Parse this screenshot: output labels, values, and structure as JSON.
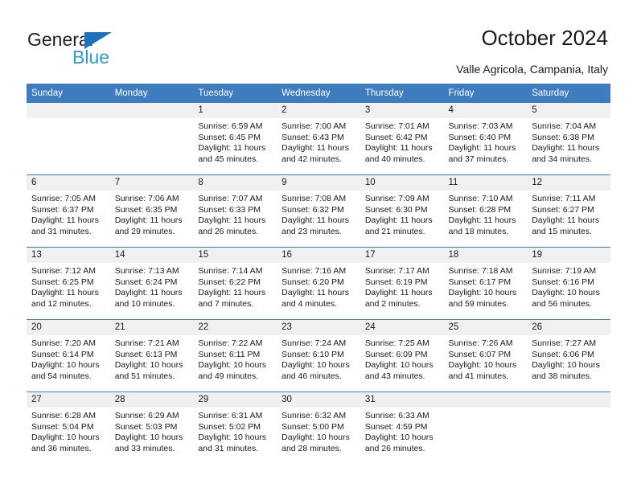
{
  "brand": {
    "name_part1": "General",
    "name_part2": "Blue",
    "logo_icon": "blue-triangle-icon"
  },
  "header": {
    "title": "October 2024",
    "subtitle": "Valle Agricola, Campania, Italy"
  },
  "colors": {
    "header_blue": "#3d7cbf",
    "brand_dark": "#231f20",
    "brand_blue": "#2e9bd6",
    "logo_triangle": "#1c72bb",
    "daynum_band": "#f0f0f0"
  },
  "calendar": {
    "weekday_headers": [
      "Sunday",
      "Monday",
      "Tuesday",
      "Wednesday",
      "Thursday",
      "Friday",
      "Saturday"
    ],
    "weeks": [
      [
        {
          "day": "",
          "lines": []
        },
        {
          "day": "",
          "lines": []
        },
        {
          "day": "1",
          "lines": [
            "Sunrise: 6:59 AM",
            "Sunset: 6:45 PM",
            "Daylight: 11 hours",
            "and 45 minutes."
          ]
        },
        {
          "day": "2",
          "lines": [
            "Sunrise: 7:00 AM",
            "Sunset: 6:43 PM",
            "Daylight: 11 hours",
            "and 42 minutes."
          ]
        },
        {
          "day": "3",
          "lines": [
            "Sunrise: 7:01 AM",
            "Sunset: 6:42 PM",
            "Daylight: 11 hours",
            "and 40 minutes."
          ]
        },
        {
          "day": "4",
          "lines": [
            "Sunrise: 7:03 AM",
            "Sunset: 6:40 PM",
            "Daylight: 11 hours",
            "and 37 minutes."
          ]
        },
        {
          "day": "5",
          "lines": [
            "Sunrise: 7:04 AM",
            "Sunset: 6:38 PM",
            "Daylight: 11 hours",
            "and 34 minutes."
          ]
        }
      ],
      [
        {
          "day": "6",
          "lines": [
            "Sunrise: 7:05 AM",
            "Sunset: 6:37 PM",
            "Daylight: 11 hours",
            "and 31 minutes."
          ]
        },
        {
          "day": "7",
          "lines": [
            "Sunrise: 7:06 AM",
            "Sunset: 6:35 PM",
            "Daylight: 11 hours",
            "and 29 minutes."
          ]
        },
        {
          "day": "8",
          "lines": [
            "Sunrise: 7:07 AM",
            "Sunset: 6:33 PM",
            "Daylight: 11 hours",
            "and 26 minutes."
          ]
        },
        {
          "day": "9",
          "lines": [
            "Sunrise: 7:08 AM",
            "Sunset: 6:32 PM",
            "Daylight: 11 hours",
            "and 23 minutes."
          ]
        },
        {
          "day": "10",
          "lines": [
            "Sunrise: 7:09 AM",
            "Sunset: 6:30 PM",
            "Daylight: 11 hours",
            "and 21 minutes."
          ]
        },
        {
          "day": "11",
          "lines": [
            "Sunrise: 7:10 AM",
            "Sunset: 6:28 PM",
            "Daylight: 11 hours",
            "and 18 minutes."
          ]
        },
        {
          "day": "12",
          "lines": [
            "Sunrise: 7:11 AM",
            "Sunset: 6:27 PM",
            "Daylight: 11 hours",
            "and 15 minutes."
          ]
        }
      ],
      [
        {
          "day": "13",
          "lines": [
            "Sunrise: 7:12 AM",
            "Sunset: 6:25 PM",
            "Daylight: 11 hours",
            "and 12 minutes."
          ]
        },
        {
          "day": "14",
          "lines": [
            "Sunrise: 7:13 AM",
            "Sunset: 6:24 PM",
            "Daylight: 11 hours",
            "and 10 minutes."
          ]
        },
        {
          "day": "15",
          "lines": [
            "Sunrise: 7:14 AM",
            "Sunset: 6:22 PM",
            "Daylight: 11 hours",
            "and 7 minutes."
          ]
        },
        {
          "day": "16",
          "lines": [
            "Sunrise: 7:16 AM",
            "Sunset: 6:20 PM",
            "Daylight: 11 hours",
            "and 4 minutes."
          ]
        },
        {
          "day": "17",
          "lines": [
            "Sunrise: 7:17 AM",
            "Sunset: 6:19 PM",
            "Daylight: 11 hours",
            "and 2 minutes."
          ]
        },
        {
          "day": "18",
          "lines": [
            "Sunrise: 7:18 AM",
            "Sunset: 6:17 PM",
            "Daylight: 10 hours",
            "and 59 minutes."
          ]
        },
        {
          "day": "19",
          "lines": [
            "Sunrise: 7:19 AM",
            "Sunset: 6:16 PM",
            "Daylight: 10 hours",
            "and 56 minutes."
          ]
        }
      ],
      [
        {
          "day": "20",
          "lines": [
            "Sunrise: 7:20 AM",
            "Sunset: 6:14 PM",
            "Daylight: 10 hours",
            "and 54 minutes."
          ]
        },
        {
          "day": "21",
          "lines": [
            "Sunrise: 7:21 AM",
            "Sunset: 6:13 PM",
            "Daylight: 10 hours",
            "and 51 minutes."
          ]
        },
        {
          "day": "22",
          "lines": [
            "Sunrise: 7:22 AM",
            "Sunset: 6:11 PM",
            "Daylight: 10 hours",
            "and 49 minutes."
          ]
        },
        {
          "day": "23",
          "lines": [
            "Sunrise: 7:24 AM",
            "Sunset: 6:10 PM",
            "Daylight: 10 hours",
            "and 46 minutes."
          ]
        },
        {
          "day": "24",
          "lines": [
            "Sunrise: 7:25 AM",
            "Sunset: 6:09 PM",
            "Daylight: 10 hours",
            "and 43 minutes."
          ]
        },
        {
          "day": "25",
          "lines": [
            "Sunrise: 7:26 AM",
            "Sunset: 6:07 PM",
            "Daylight: 10 hours",
            "and 41 minutes."
          ]
        },
        {
          "day": "26",
          "lines": [
            "Sunrise: 7:27 AM",
            "Sunset: 6:06 PM",
            "Daylight: 10 hours",
            "and 38 minutes."
          ]
        }
      ],
      [
        {
          "day": "27",
          "lines": [
            "Sunrise: 6:28 AM",
            "Sunset: 5:04 PM",
            "Daylight: 10 hours",
            "and 36 minutes."
          ]
        },
        {
          "day": "28",
          "lines": [
            "Sunrise: 6:29 AM",
            "Sunset: 5:03 PM",
            "Daylight: 10 hours",
            "and 33 minutes."
          ]
        },
        {
          "day": "29",
          "lines": [
            "Sunrise: 6:31 AM",
            "Sunset: 5:02 PM",
            "Daylight: 10 hours",
            "and 31 minutes."
          ]
        },
        {
          "day": "30",
          "lines": [
            "Sunrise: 6:32 AM",
            "Sunset: 5:00 PM",
            "Daylight: 10 hours",
            "and 28 minutes."
          ]
        },
        {
          "day": "31",
          "lines": [
            "Sunrise: 6:33 AM",
            "Sunset: 4:59 PM",
            "Daylight: 10 hours",
            "and 26 minutes."
          ]
        },
        {
          "day": "",
          "lines": []
        },
        {
          "day": "",
          "lines": []
        }
      ]
    ]
  }
}
